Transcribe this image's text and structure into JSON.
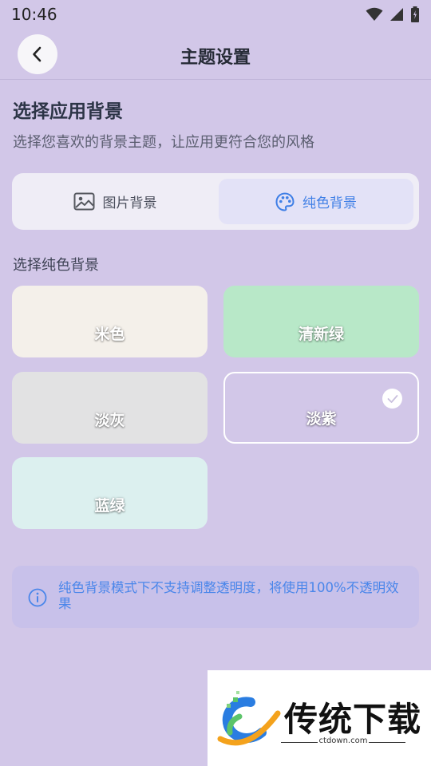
{
  "status_bar": {
    "time": "10:46"
  },
  "header": {
    "title": "主题设置"
  },
  "section": {
    "title": "选择应用背景",
    "description": "选择您喜欢的背景主题，让应用更符合您的风格"
  },
  "tabs": [
    {
      "label": "图片背景",
      "icon": "image-icon",
      "active": false
    },
    {
      "label": "纯色背景",
      "icon": "palette-icon",
      "active": true
    }
  ],
  "solid_section": {
    "title": "选择纯色背景"
  },
  "swatches": [
    {
      "label": "米色",
      "color": "#f4f0ea",
      "selected": false
    },
    {
      "label": "清新绿",
      "color": "#b8e8c8",
      "selected": false
    },
    {
      "label": "淡灰",
      "color": "#e2e2e3",
      "selected": false
    },
    {
      "label": "淡紫",
      "color": "#d2c7e8",
      "selected": true
    },
    {
      "label": "蓝绿",
      "color": "#dcf0ef",
      "selected": false
    }
  ],
  "info": {
    "text": "纯色背景模式下不支持调整透明度，将使用100%不透明效果"
  },
  "watermark": {
    "brand": "传统下载",
    "url": "ctdown.com"
  },
  "colors": {
    "accent": "#3f7fe6",
    "background": "#d2c7e8"
  }
}
